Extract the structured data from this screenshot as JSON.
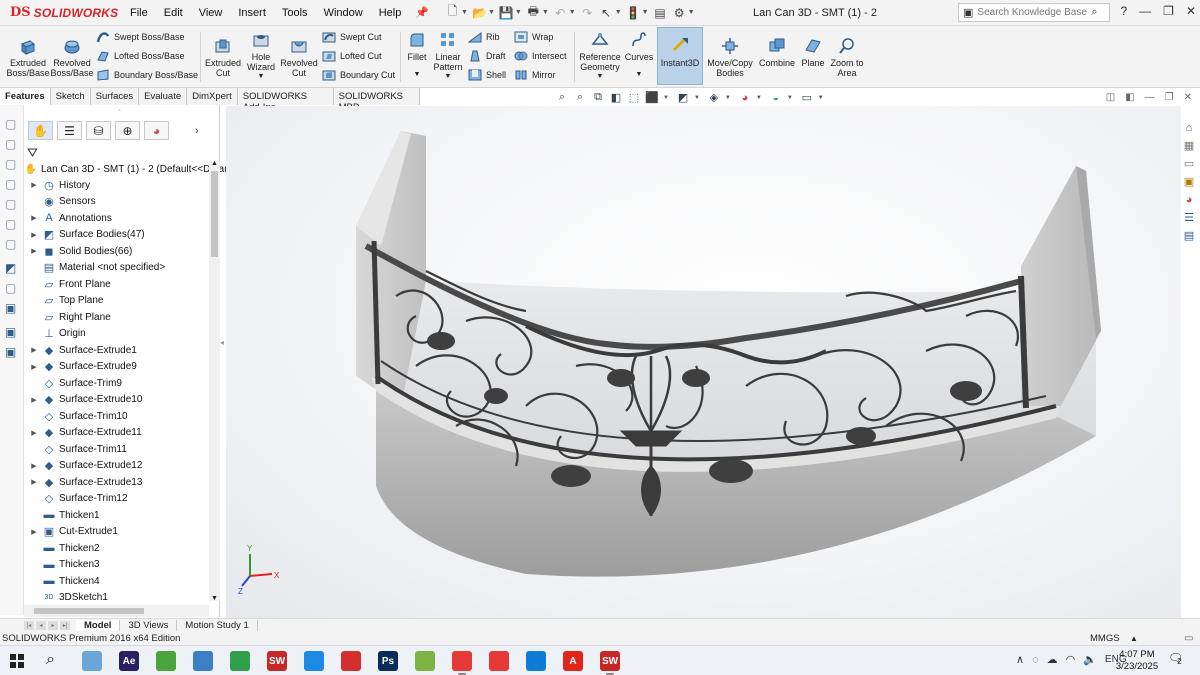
{
  "app": {
    "logo_text": "SOLIDWORKS",
    "menu": [
      "File",
      "Edit",
      "View",
      "Insert",
      "Tools",
      "Window",
      "Help"
    ],
    "document_title": "Lan Can 3D - SMT (1) - 2",
    "search_placeholder": "Search Knowledge Base",
    "quick_access_icons": [
      "new-document-icon",
      "open-icon",
      "save-icon",
      "print-icon",
      "undo-icon",
      "select-icon",
      "rebuild-icon",
      "file-properties-icon",
      "options-icon"
    ]
  },
  "command_manager": {
    "tools": {
      "extruded_boss": "Extruded\nBoss/Base",
      "revolved_boss": "Revolved\nBoss/Base",
      "swept_boss": "Swept Boss/Base",
      "lofted_boss": "Lofted Boss/Base",
      "boundary_boss": "Boundary Boss/Base",
      "extruded_cut": "Extruded\nCut",
      "hole_wizard": "Hole\nWizard",
      "revolved_cut": "Revolved\nCut",
      "swept_cut": "Swept Cut",
      "lofted_cut": "Lofted Cut",
      "boundary_cut": "Boundary Cut",
      "fillet": "Fillet",
      "linear_pattern": "Linear\nPattern",
      "rib": "Rib",
      "draft": "Draft",
      "shell": "Shell",
      "wrap": "Wrap",
      "intersect": "Intersect",
      "mirror": "Mirror",
      "reference_geometry": "Reference\nGeometry",
      "curves": "Curves",
      "instant3d": "Instant3D",
      "move_copy": "Move/Copy\nBodies",
      "combine": "Combine",
      "plane": "Plane",
      "zoom_to_area": "Zoom to\nArea"
    },
    "tabs": [
      "Features",
      "Sketch",
      "Surfaces",
      "Evaluate",
      "DimXpert",
      "SOLIDWORKS Add-Ins",
      "SOLIDWORKS MBD"
    ]
  },
  "feature_tree": {
    "root": "Lan Can 3D - SMT (1) - 2  (Default<<Defau",
    "items": [
      {
        "label": "History",
        "icon": "history-icon",
        "expand": true
      },
      {
        "label": "Sensors",
        "icon": "sensors-icon",
        "expand": false
      },
      {
        "label": "Annotations",
        "icon": "annotations-icon",
        "expand": true
      },
      {
        "label": "Surface Bodies(47)",
        "icon": "surface-bodies-icon",
        "expand": true
      },
      {
        "label": "Solid Bodies(66)",
        "icon": "solid-bodies-icon",
        "expand": true
      },
      {
        "label": "Material <not specified>",
        "icon": "material-icon",
        "expand": false
      },
      {
        "label": "Front Plane",
        "icon": "plane-icon",
        "expand": false
      },
      {
        "label": "Top Plane",
        "icon": "plane-icon",
        "expand": false
      },
      {
        "label": "Right Plane",
        "icon": "plane-icon",
        "expand": false
      },
      {
        "label": "Origin",
        "icon": "origin-icon",
        "expand": false
      },
      {
        "label": "Surface-Extrude1",
        "icon": "surface-extrude-icon",
        "expand": true
      },
      {
        "label": "Surface-Extrude9",
        "icon": "surface-extrude-icon",
        "expand": true
      },
      {
        "label": "Surface-Trim9",
        "icon": "surface-trim-icon",
        "expand": false
      },
      {
        "label": "Surface-Extrude10",
        "icon": "surface-extrude-icon",
        "expand": true
      },
      {
        "label": "Surface-Trim10",
        "icon": "surface-trim-icon",
        "expand": false
      },
      {
        "label": "Surface-Extrude11",
        "icon": "surface-extrude-icon",
        "expand": true
      },
      {
        "label": "Surface-Trim11",
        "icon": "surface-trim-icon",
        "expand": false
      },
      {
        "label": "Surface-Extrude12",
        "icon": "surface-extrude-icon",
        "expand": true
      },
      {
        "label": "Surface-Extrude13",
        "icon": "surface-extrude-icon",
        "expand": true
      },
      {
        "label": "Surface-Trim12",
        "icon": "surface-trim-icon",
        "expand": false
      },
      {
        "label": "Thicken1",
        "icon": "thicken-icon",
        "expand": false
      },
      {
        "label": "Cut-Extrude1",
        "icon": "cut-extrude-icon",
        "expand": true
      },
      {
        "label": "Thicken2",
        "icon": "thicken-icon",
        "expand": false
      },
      {
        "label": "Thicken3",
        "icon": "thicken-icon",
        "expand": false
      },
      {
        "label": "Thicken4",
        "icon": "thicken-icon",
        "expand": false
      },
      {
        "label": "3DSketch1",
        "icon": "3dsketch-icon",
        "expand": false
      }
    ]
  },
  "bottom_tabs": [
    "Model",
    "3D Views",
    "Motion Study 1"
  ],
  "status": {
    "edition": "SOLIDWORKS Premium 2016 x64 Edition",
    "units": "MMGS"
  },
  "triad": {
    "x": "X",
    "y": "Y",
    "z": "Z"
  },
  "taskbar": {
    "apps": [
      {
        "name": "paint-app",
        "label": "",
        "color": "#6aa7d8"
      },
      {
        "name": "after-effects-app",
        "label": "Ae",
        "color": "#2a1f63"
      },
      {
        "name": "green-app",
        "label": "",
        "color": "#4aa33c"
      },
      {
        "name": "calculator-app",
        "label": "",
        "color": "#3d7fc4"
      },
      {
        "name": "camtasia-app",
        "label": "",
        "color": "#2fa04a"
      },
      {
        "name": "solidworks-app",
        "label": "SW",
        "color": "#c62828"
      },
      {
        "name": "tool-app",
        "label": "",
        "color": "#1e88e5"
      },
      {
        "name": "red-green-app",
        "label": "",
        "color": "#d32f2f"
      },
      {
        "name": "photoshop-app",
        "label": "Ps",
        "color": "#0b2b5c"
      },
      {
        "name": "green-swirl-app",
        "label": "",
        "color": "#7cb342"
      },
      {
        "name": "chrome-app",
        "label": "",
        "color": "#e53935"
      },
      {
        "name": "sketch-app",
        "label": "",
        "color": "#e53935"
      },
      {
        "name": "edge-app",
        "label": "",
        "color": "#0f7bd4"
      },
      {
        "name": "acrobat-app",
        "label": "A",
        "color": "#e1251b"
      },
      {
        "name": "solidworks-2016-app",
        "label": "SW",
        "color": "#c62828"
      }
    ],
    "language": "ENG",
    "time": "4:07 PM",
    "date": "3/23/2025",
    "notification_count": "2"
  }
}
